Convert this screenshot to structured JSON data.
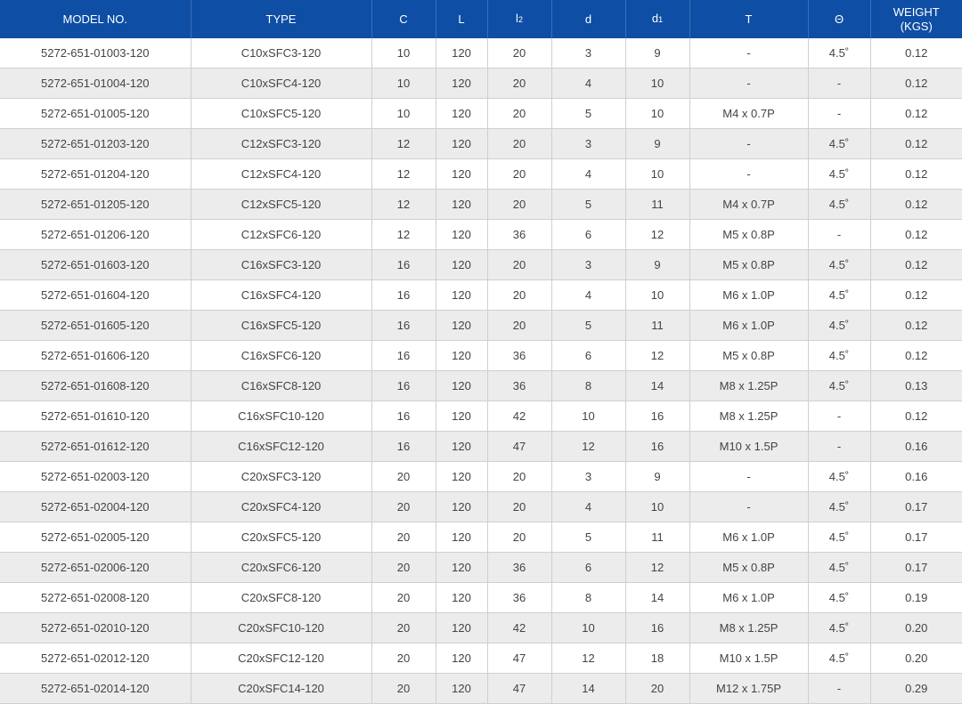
{
  "header": {
    "model": "MODEL NO.",
    "type": "TYPE",
    "c": "C",
    "l": "L",
    "l2_main": "l",
    "l2_sub": "2",
    "d": "d",
    "d1_main": "d",
    "d1_sub": "1",
    "t": "T",
    "theta": "Θ",
    "weight_line1": "WEIGHT",
    "weight_line2": "(KGS)"
  },
  "rows": [
    [
      "5272-651-01003-120",
      "C10xSFC3-120",
      "10",
      "120",
      "20",
      "3",
      "9",
      "-",
      "4.5˚",
      "0.12"
    ],
    [
      "5272-651-01004-120",
      "C10xSFC4-120",
      "10",
      "120",
      "20",
      "4",
      "10",
      "-",
      "-",
      "0.12"
    ],
    [
      "5272-651-01005-120",
      "C10xSFC5-120",
      "10",
      "120",
      "20",
      "5",
      "10",
      "M4 x 0.7P",
      "-",
      "0.12"
    ],
    [
      "5272-651-01203-120",
      "C12xSFC3-120",
      "12",
      "120",
      "20",
      "3",
      "9",
      "-",
      "4.5˚",
      "0.12"
    ],
    [
      "5272-651-01204-120",
      "C12xSFC4-120",
      "12",
      "120",
      "20",
      "4",
      "10",
      "-",
      "4.5˚",
      "0.12"
    ],
    [
      "5272-651-01205-120",
      "C12xSFC5-120",
      "12",
      "120",
      "20",
      "5",
      "11",
      "M4 x 0.7P",
      "4.5˚",
      "0.12"
    ],
    [
      "5272-651-01206-120",
      "C12xSFC6-120",
      "12",
      "120",
      "36",
      "6",
      "12",
      "M5 x 0.8P",
      "-",
      "0.12"
    ],
    [
      "5272-651-01603-120",
      "C16xSFC3-120",
      "16",
      "120",
      "20",
      "3",
      "9",
      "M5 x 0.8P",
      "4.5˚",
      "0.12"
    ],
    [
      "5272-651-01604-120",
      "C16xSFC4-120",
      "16",
      "120",
      "20",
      "4",
      "10",
      "M6 x 1.0P",
      "4.5˚",
      "0.12"
    ],
    [
      "5272-651-01605-120",
      "C16xSFC5-120",
      "16",
      "120",
      "20",
      "5",
      "11",
      "M6 x 1.0P",
      "4.5˚",
      "0.12"
    ],
    [
      "5272-651-01606-120",
      "C16xSFC6-120",
      "16",
      "120",
      "36",
      "6",
      "12",
      "M5 x 0.8P",
      "4.5˚",
      "0.12"
    ],
    [
      "5272-651-01608-120",
      "C16xSFC8-120",
      "16",
      "120",
      "36",
      "8",
      "14",
      "M8 x 1.25P",
      "4.5˚",
      "0.13"
    ],
    [
      "5272-651-01610-120",
      "C16xSFC10-120",
      "16",
      "120",
      "42",
      "10",
      "16",
      "M8 x 1.25P",
      "-",
      "0.12"
    ],
    [
      "5272-651-01612-120",
      "C16xSFC12-120",
      "16",
      "120",
      "47",
      "12",
      "16",
      "M10 x 1.5P",
      "-",
      "0.16"
    ],
    [
      "5272-651-02003-120",
      "C20xSFC3-120",
      "20",
      "120",
      "20",
      "3",
      "9",
      "-",
      "4.5˚",
      "0.16"
    ],
    [
      "5272-651-02004-120",
      "C20xSFC4-120",
      "20",
      "120",
      "20",
      "4",
      "10",
      "-",
      "4.5˚",
      "0.17"
    ],
    [
      "5272-651-02005-120",
      "C20xSFC5-120",
      "20",
      "120",
      "20",
      "5",
      "11",
      "M6 x 1.0P",
      "4.5˚",
      "0.17"
    ],
    [
      "5272-651-02006-120",
      "C20xSFC6-120",
      "20",
      "120",
      "36",
      "6",
      "12",
      "M5 x 0.8P",
      "4.5˚",
      "0.17"
    ],
    [
      "5272-651-02008-120",
      "C20xSFC8-120",
      "20",
      "120",
      "36",
      "8",
      "14",
      "M6 x 1.0P",
      "4.5˚",
      "0.19"
    ],
    [
      "5272-651-02010-120",
      "C20xSFC10-120",
      "20",
      "120",
      "42",
      "10",
      "16",
      "M8 x 1.25P",
      "4.5˚",
      "0.20"
    ],
    [
      "5272-651-02012-120",
      "C20xSFC12-120",
      "20",
      "120",
      "47",
      "12",
      "18",
      "M10 x 1.5P",
      "4.5˚",
      "0.20"
    ],
    [
      "5272-651-02014-120",
      "C20xSFC14-120",
      "20",
      "120",
      "47",
      "14",
      "20",
      "M12 x 1.75P",
      "-",
      "0.29"
    ]
  ],
  "colors": {
    "header_bg": "#0e4ea5",
    "header_text": "#ffffff",
    "row_alt_bg": "#ececec",
    "cell_text": "#444444",
    "grid_line": "#cfcfcf"
  }
}
